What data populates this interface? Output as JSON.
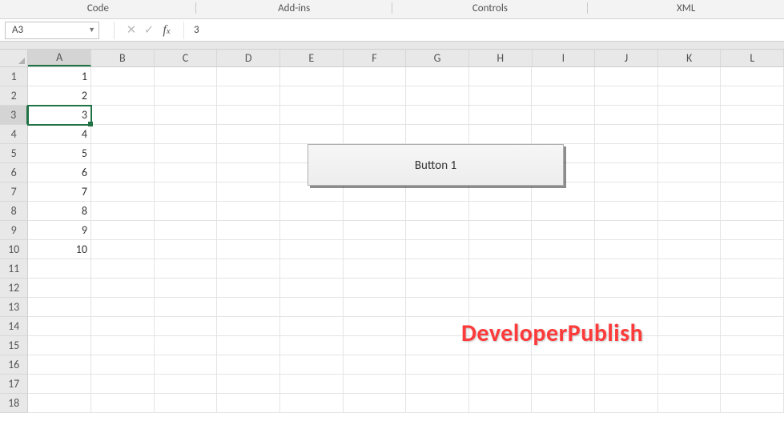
{
  "ribbon": {
    "groups": [
      "Code",
      "Add-ins",
      "Controls",
      "XML"
    ]
  },
  "namebox": {
    "value": "A3"
  },
  "formula": {
    "value": "3"
  },
  "columns": [
    "A",
    "B",
    "C",
    "D",
    "E",
    "F",
    "G",
    "H",
    "I",
    "J",
    "K",
    "L"
  ],
  "rowCount": 18,
  "selected": {
    "row": 3,
    "col": 1,
    "colLetter": "A"
  },
  "cells": {
    "A1": "1",
    "A2": "2",
    "A3": "3",
    "A4": "4",
    "A5": "5",
    "A6": "6",
    "A7": "7",
    "A8": "8",
    "A9": "9",
    "A10": "10"
  },
  "button": {
    "label": "Button 1"
  },
  "watermark": "DeveloperPublish"
}
